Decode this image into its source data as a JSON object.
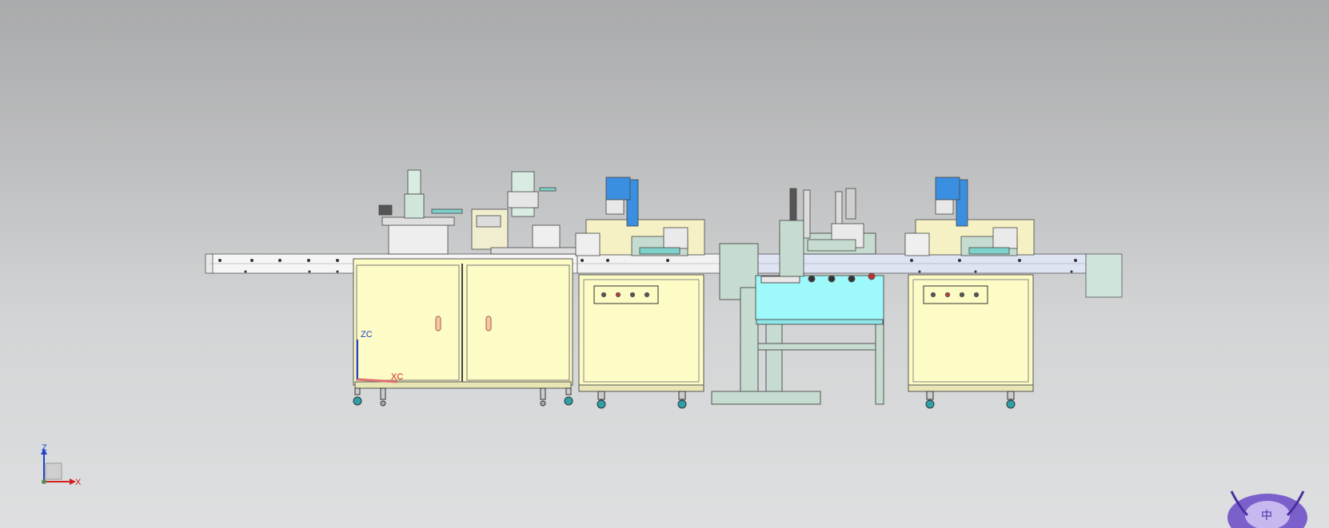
{
  "viewport": {
    "colors": {
      "cabinet": "#fdfbc4",
      "conveyor": "#f4f4f4",
      "conveyor_tinted": "#dde3f4",
      "frame_green": "#c6dcd0",
      "actuator_blue": "#3b8fe0",
      "panel_cyan": "#9ef9fa",
      "caster_teal": "#2ea1a8",
      "z_axis": "#2244cc",
      "x_axis": "#d02020"
    }
  },
  "work_csys": {
    "zc_label": "ZC",
    "xc_label": "XC"
  },
  "view_triad": {
    "z_label": "Z",
    "x_label": "X"
  },
  "watermark": {
    "text": "中"
  }
}
